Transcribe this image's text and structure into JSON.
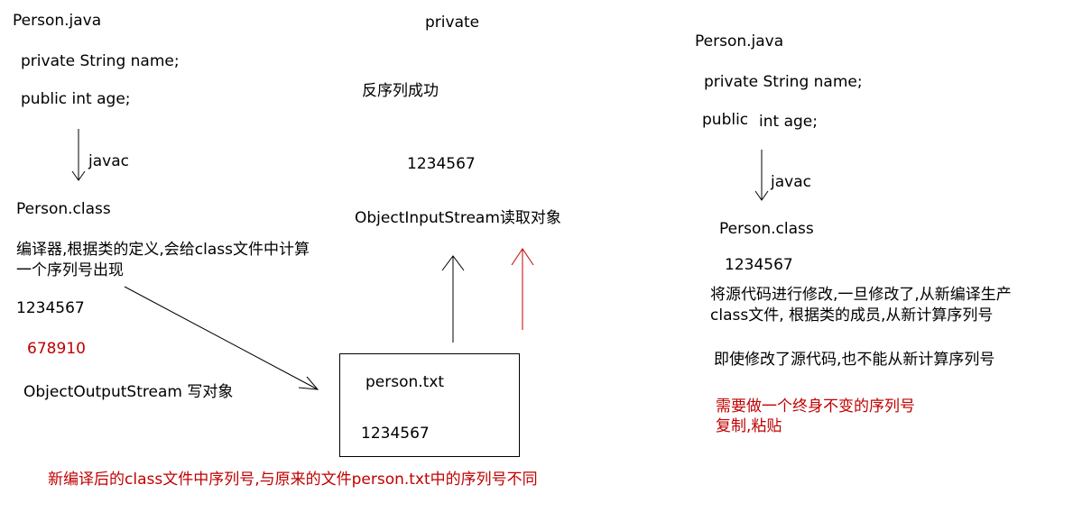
{
  "left": {
    "file_title": "Person.java",
    "line1": "private String name;",
    "line2": "public  int age;",
    "javac": "javac",
    "class_title": "Person.class",
    "compiler_note": "编译器,根据类的定义,会给class文件中计算一个序列号出现",
    "serial": "1234567",
    "new_serial": "678910",
    "output_stream": "ObjectOutputStream 写对象"
  },
  "middle": {
    "private": "private",
    "deserialize_ok": "反序列成功",
    "serial": "1234567",
    "input_stream": "ObjectInputStream读取对象",
    "file_box_title": "person.txt",
    "file_box_serial": "1234567",
    "bottom_note": "新编译后的class文件中序列号,与原来的文件person.txt中的序列号不同"
  },
  "right": {
    "file_title": "Person.java",
    "line1": "private String name;",
    "line2_a": "public",
    "line2_b": "int age;",
    "javac": "javac",
    "class_title": "Person.class",
    "serial": "1234567",
    "modify_note": "将源代码进行修改,一旦修改了,从新编译生产class文件, 根据类的成员,从新计算序列号",
    "even_if_note": "即使修改了源代码,也不能从新计算序列号",
    "need_fixed": "需要做一个终身不变的序列号",
    "copy_paste": "复制,粘贴"
  },
  "colors": {
    "text": "#000000",
    "accent_red": "#c00000"
  }
}
